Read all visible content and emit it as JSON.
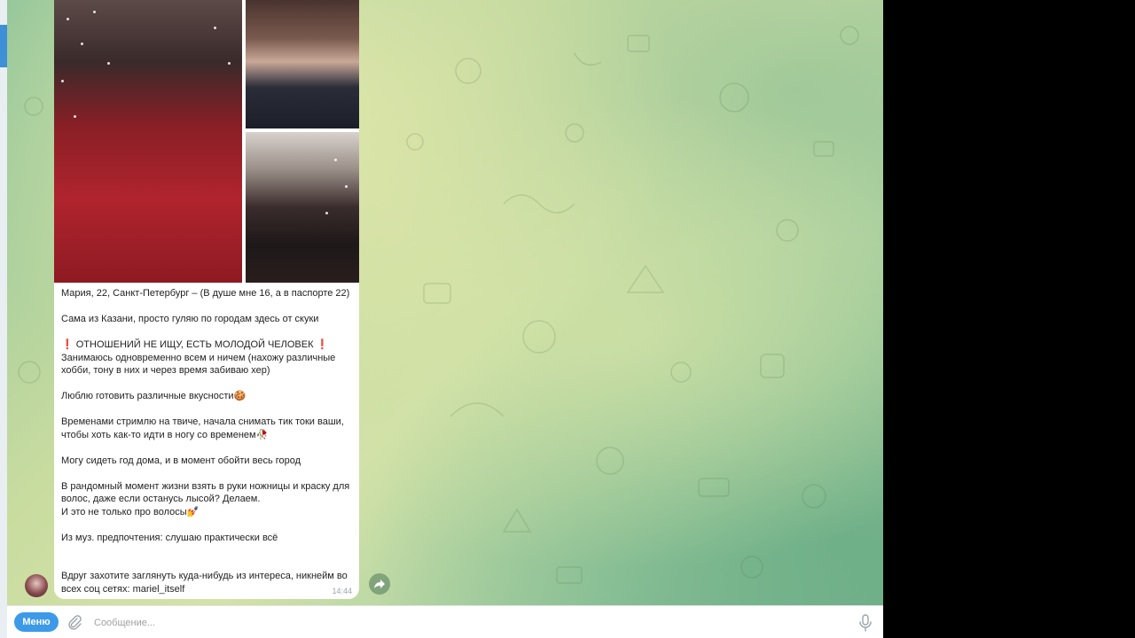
{
  "message": {
    "lines": [
      "Мария, 22, Санкт-Петербург – (В душе мне 16, а в паспорте 22)",
      "Сама из Казани, просто гуляю по городам здесь от скуки",
      "❗ ОТНОШЕНИЙ НЕ ИЩУ, ЕСТЬ МОЛОДОЙ ЧЕЛОВЕК ❗",
      "Занимаюсь одновременно всем и ничем (нахожу различные\nхобби, тону в них и через время забиваю хер)",
      "Люблю готовить различные вкусности🍪",
      "Временами стримлю на твиче, начала снимать тик токи ваши,\nчтобы хоть как-то идти в ногу со временем🥀",
      "Могу сидеть год дома, и в момент обойти весь город",
      "В рандомный момент жизни взять в руки ножницы и краску для\nволос, даже если останусь лысой? Делаем.\nИ это не только про волосы💅",
      "Из муз. предпочтения: слушаю практически всё",
      "Вдруг захотите заглянуть куда-нибудь из интереса, никнейм во\nвсех соц сетях: mariel_itself"
    ],
    "time": "14:44"
  },
  "composer": {
    "menu_label": "Меню",
    "placeholder": "Сообщение..."
  },
  "icons": {
    "attach": "paperclip-icon",
    "mic": "microphone-icon",
    "forward": "forward-arrow-icon"
  },
  "colors": {
    "accent": "#3d9ae8",
    "bubble": "#ffffff",
    "time": "#9aa7b0"
  }
}
